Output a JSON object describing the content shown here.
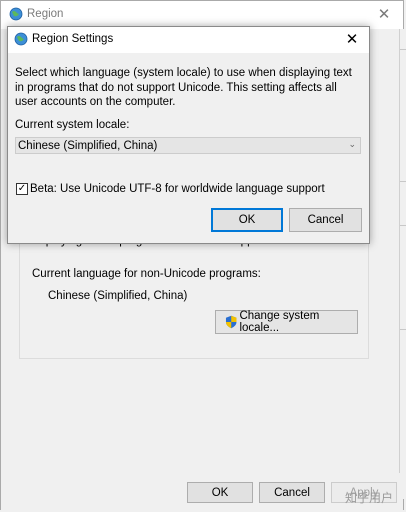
{
  "background_window": {
    "title": "Region",
    "close_glyph": "✕",
    "partial_text": "displaying text in programs that do not support Unicode.",
    "current_language_label": "Current language for non-Unicode programs:",
    "current_language_value": "Chinese (Simplified, China)",
    "change_locale_button": "Change system locale...",
    "buttons": {
      "ok": "OK",
      "cancel": "Cancel",
      "apply": "Apply"
    }
  },
  "dialog": {
    "title": "Region Settings",
    "close_glyph": "✕",
    "description": "Select which language (system locale) to use when displaying text in programs that do not support Unicode. This setting affects all user accounts on the computer.",
    "locale_label": "Current system locale:",
    "locale_value": "Chinese (Simplified, China)",
    "utf8_label": "Beta: Use Unicode UTF-8 for worldwide language support",
    "utf8_checked": true,
    "check_glyph": "✓",
    "ok_label": "OK",
    "cancel_label": "Cancel"
  },
  "watermark": "知乎用户",
  "colors": {
    "accent": "#0078d7",
    "window_bg": "#f0f0f0",
    "titlebar_bg": "#ffffff",
    "button_bg": "#e1e1e1",
    "shield_blue": "#2a6fd1",
    "shield_yellow": "#f3c200"
  },
  "icons": [
    "globe-icon",
    "close-icon",
    "shield-icon",
    "dropdown-arrow-icon",
    "checkmark-icon"
  ]
}
